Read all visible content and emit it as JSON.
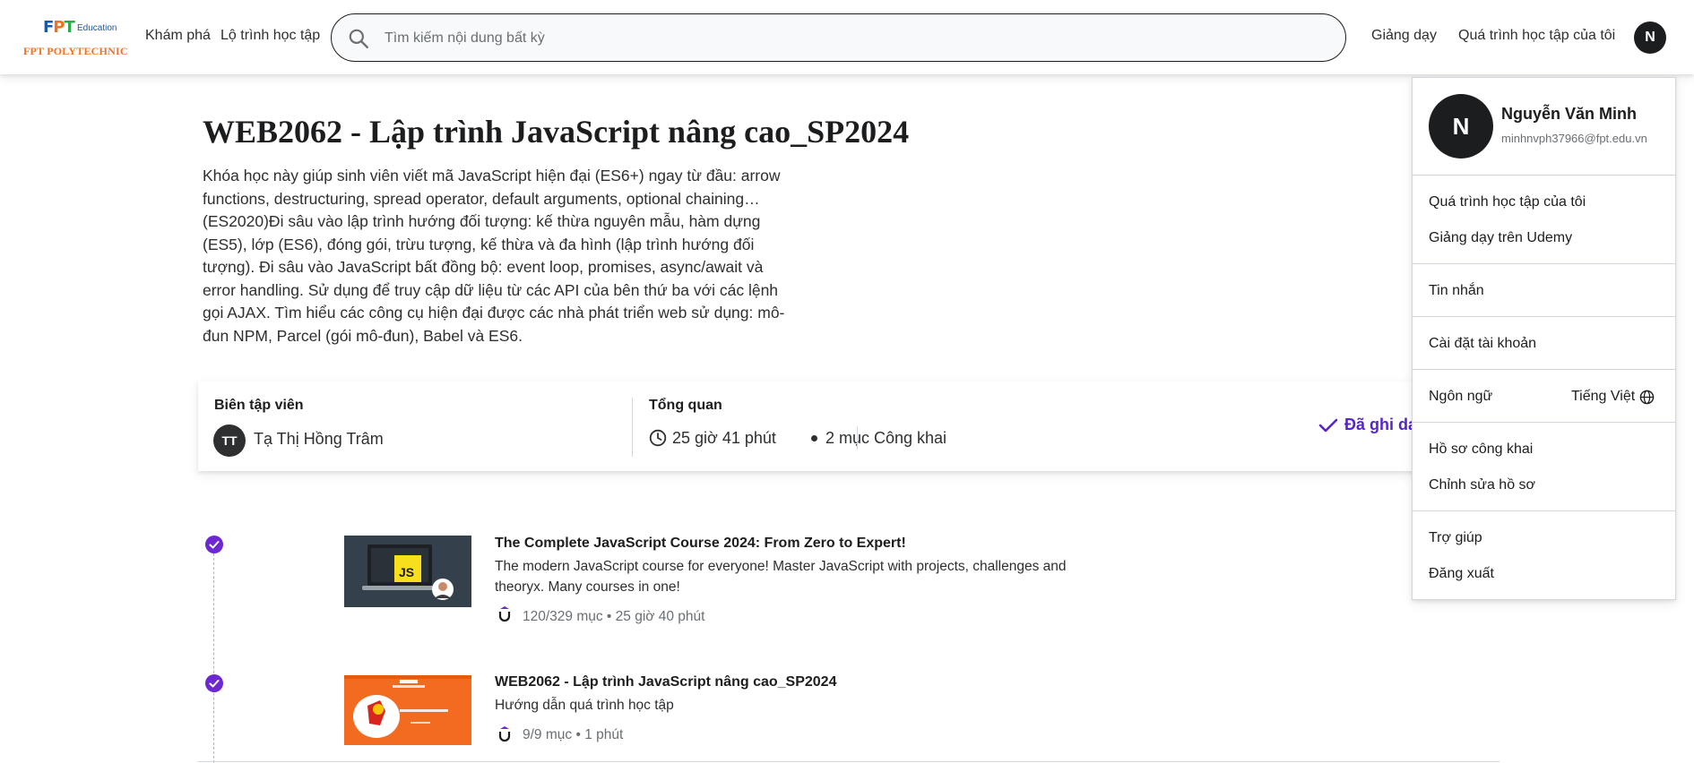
{
  "header": {
    "logo": {
      "brand": "FPT",
      "edu": "Education",
      "school": "FPT POLYTECHNIC"
    },
    "nav": {
      "explore": "Khám phá",
      "learning_path": "Lộ trình học tập"
    },
    "search": {
      "placeholder": "Tìm kiếm nội dung bất kỳ",
      "icon": "search-icon"
    },
    "right": {
      "teach": "Giảng dạy",
      "my_learning": "Quá trình học tập của tôi",
      "avatar_initial": "N"
    }
  },
  "course": {
    "title": "WEB2062 - Lập trình JavaScript nâng cao_SP2024",
    "description": "Khóa học này giúp sinh viên viết mã JavaScript hiện đại (ES6+) ngay từ đầu: arrow functions, destructuring, spread operator, default arguments, optional chaining…(ES2020)Đi sâu vào lập trình hướng đối tượng: kế thừa nguyên mẫu, hàm dựng (ES5), lớp (ES6), đóng gói, trừu tượng, kế thừa và đa hình (lập trình hướng đối tượng). Đi sâu vào JavaScript bất đồng bộ: event loop, promises, async/await và error handling. Sử dụng để truy cập dữ liệu từ các API của bên thứ ba với các lệnh gọi AJAX. Tìm hiểu các công cụ hiện đại được các nhà phát triển web sử dụng: mô-đun NPM, Parcel (gói mô-đun), Babel và ES6."
  },
  "info": {
    "editor_label": "Biên tập viên",
    "editor_initials": "TT",
    "editor_name": "Tạ Thị Hồng Trâm",
    "overview_label": "Tổng quan",
    "duration": "25 giờ 41 phút",
    "items": "2 mục",
    "visibility": "Công khai",
    "enrolled": "Đã ghi danh"
  },
  "items": [
    {
      "title": "The Complete JavaScript Course 2024: From Zero to Expert!",
      "subtitle": "The modern JavaScript course for everyone! Master JavaScript with projects, challenges and theoryx. Many courses in one!",
      "progress": "120/329 mục",
      "duration": "25 giờ 40 phút",
      "completed": true
    },
    {
      "title": "WEB2062 - Lập trình JavaScript nâng cao_SP2024",
      "subtitle": "Hướng dẫn quá trình học tập",
      "progress": "9/9 mục",
      "duration": "1 phút",
      "completed": true
    }
  ],
  "dropdown": {
    "avatar_initial": "N",
    "name": "Nguyễn Văn Minh",
    "email": "minhnvph37966@fpt.edu.vn",
    "my_learning": "Quá trình học tập của tôi",
    "teach_udemy": "Giảng dạy trên Udemy",
    "messages": "Tin nhắn",
    "account_settings": "Cài đặt tài khoản",
    "language_label": "Ngôn ngữ",
    "language_value": "Tiếng Việt",
    "public_profile": "Hồ sơ công khai",
    "edit_profile": "Chỉnh sửa hồ sơ",
    "help": "Trợ giúp",
    "logout": "Đăng xuất"
  },
  "colors": {
    "accent": "#5624d0",
    "check": "#6d28d2",
    "text": "#1c1d1f",
    "muted": "#6a6f73"
  }
}
